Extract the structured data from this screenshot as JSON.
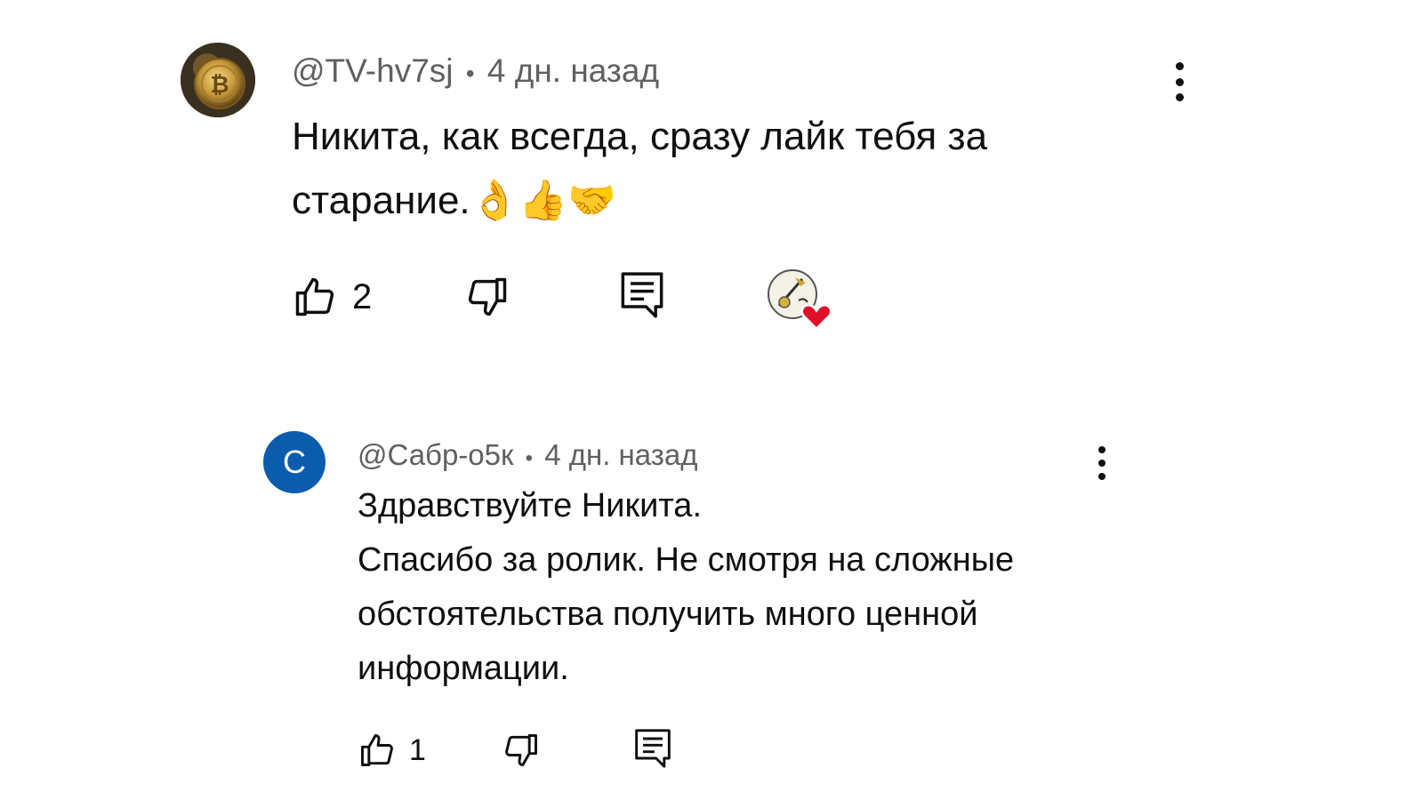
{
  "comments": [
    {
      "author": "@TV-hv7sj",
      "separator": "•",
      "time": "4 дн. назад",
      "text": "Никита, как всегда, сразу лайк тебя за\nстарание.👌👍🤝",
      "likes": "2",
      "avatar_icon": "bitcoin-coin-avatar",
      "creator_heart": true
    },
    {
      "author": "@Сабр-о5к",
      "separator": "•",
      "time": "4 дн. назад",
      "text": "Здравствуйте Никита.\nСпасибо за ролик. Не смотря на сложные\nобстоятельства получить много ценной\nинформации.",
      "likes": "1",
      "avatar_letter": "С",
      "avatar_color": "#0b5cad"
    }
  ],
  "colors": {
    "meta": "#606060",
    "text": "#0f0f0f",
    "heart": "#e0102a"
  }
}
